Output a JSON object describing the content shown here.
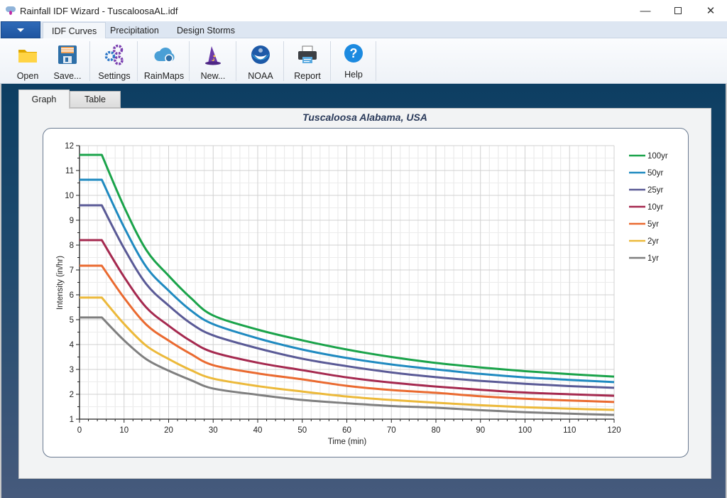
{
  "window": {
    "title": "Rainfall IDF Wizard - TuscaloosaAL.idf",
    "controls": [
      "minimize",
      "maximize",
      "close"
    ]
  },
  "ribbon": {
    "tabs": [
      {
        "label": "IDF Curves",
        "active": true
      },
      {
        "label": "Precipitation",
        "active": false
      },
      {
        "label": "Design Storms",
        "active": false
      }
    ],
    "buttons": [
      {
        "label": "Open",
        "icon": "folder-icon"
      },
      {
        "label": "Save...",
        "icon": "floppy-disk-icon"
      },
      {
        "label": "Settings",
        "icon": "gears-icon"
      },
      {
        "label": "RainMaps",
        "icon": "cloud-search-icon"
      },
      {
        "label": "New...",
        "icon": "wizard-hat-icon"
      },
      {
        "label": "NOAA",
        "icon": "noaa-logo-icon"
      },
      {
        "label": "Report",
        "icon": "printer-icon"
      },
      {
        "label": "Help",
        "icon": "help-icon"
      }
    ]
  },
  "view_tabs": [
    {
      "label": "Graph",
      "active": true
    },
    {
      "label": "Table",
      "active": false
    }
  ],
  "chart_data": {
    "type": "line",
    "title": "Tuscaloosa Alabama,  USA",
    "xlabel": "Time (min)",
    "ylabel": "Intensity (in/hr)",
    "xlim": [
      0,
      120
    ],
    "ylim": [
      1,
      12
    ],
    "xticks": [
      0,
      10,
      20,
      30,
      40,
      50,
      60,
      70,
      80,
      90,
      100,
      110,
      120
    ],
    "yticks": [
      1,
      2,
      3,
      4,
      5,
      6,
      7,
      8,
      9,
      10,
      11,
      12
    ],
    "grid": true,
    "legend": "right",
    "x": [
      0,
      5,
      10,
      15,
      20,
      25,
      30,
      40,
      50,
      60,
      70,
      80,
      90,
      100,
      110,
      120
    ],
    "series": [
      {
        "name": "100yr",
        "color": "#1aa34a",
        "values": [
          11.63,
          11.63,
          9.54,
          7.8,
          6.77,
          5.87,
          5.17,
          4.6,
          4.17,
          3.8,
          3.5,
          3.26,
          3.08,
          2.93,
          2.81,
          2.71
        ]
      },
      {
        "name": "50yr",
        "color": "#1f8ac0",
        "values": [
          10.63,
          10.63,
          8.72,
          7.12,
          6.17,
          5.37,
          4.82,
          4.25,
          3.8,
          3.46,
          3.2,
          3.0,
          2.82,
          2.68,
          2.58,
          2.49
        ]
      },
      {
        "name": "25yr",
        "color": "#5a5a96",
        "values": [
          9.6,
          9.6,
          7.87,
          6.43,
          5.57,
          4.85,
          4.37,
          3.85,
          3.43,
          3.13,
          2.88,
          2.69,
          2.54,
          2.42,
          2.33,
          2.26
        ]
      },
      {
        "name": "10yr",
        "color": "#a5294f",
        "values": [
          8.2,
          8.2,
          6.72,
          5.49,
          4.76,
          4.14,
          3.69,
          3.27,
          2.97,
          2.68,
          2.47,
          2.31,
          2.18,
          2.07,
          2.0,
          1.94
        ]
      },
      {
        "name": "5yr",
        "color": "#ea6a30",
        "values": [
          7.17,
          7.17,
          5.88,
          4.8,
          4.16,
          3.62,
          3.17,
          2.84,
          2.6,
          2.34,
          2.17,
          2.06,
          1.92,
          1.82,
          1.75,
          1.69
        ]
      },
      {
        "name": "2yr",
        "color": "#ecb93a",
        "values": [
          5.89,
          5.89,
          4.83,
          3.95,
          3.42,
          2.97,
          2.63,
          2.33,
          2.11,
          1.91,
          1.77,
          1.66,
          1.56,
          1.48,
          1.42,
          1.37
        ]
      },
      {
        "name": "1yr",
        "color": "#7f7f7f",
        "values": [
          5.09,
          5.09,
          4.17,
          3.41,
          2.95,
          2.57,
          2.23,
          1.98,
          1.77,
          1.64,
          1.53,
          1.46,
          1.36,
          1.28,
          1.22,
          1.17
        ]
      }
    ]
  }
}
